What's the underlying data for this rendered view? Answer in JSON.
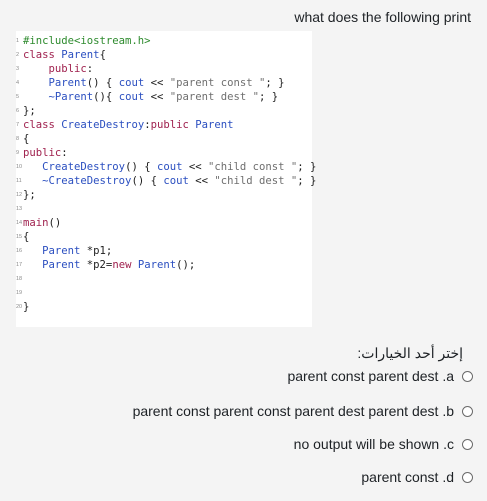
{
  "question": {
    "title": "what does the following print"
  },
  "code": {
    "lines": [
      {
        "n": "1",
        "parts": [
          {
            "t": "pre",
            "v": "#include<iostream.h>"
          }
        ]
      },
      {
        "n": "2",
        "parts": [
          {
            "t": "kw",
            "v": "class "
          },
          {
            "t": "type",
            "v": "Parent"
          },
          {
            "t": "plain",
            "v": "{"
          }
        ]
      },
      {
        "n": "3",
        "parts": [
          {
            "t": "plain",
            "v": "    "
          },
          {
            "t": "kw",
            "v": "public"
          },
          {
            "t": "plain",
            "v": ":"
          }
        ]
      },
      {
        "n": "4",
        "parts": [
          {
            "t": "plain",
            "v": "    "
          },
          {
            "t": "fn",
            "v": "Parent"
          },
          {
            "t": "plain",
            "v": "() { "
          },
          {
            "t": "fn",
            "v": "cout"
          },
          {
            "t": "plain",
            "v": " << "
          },
          {
            "t": "str",
            "v": "\"parent const \""
          },
          {
            "t": "plain",
            "v": "; }"
          }
        ]
      },
      {
        "n": "5",
        "parts": [
          {
            "t": "plain",
            "v": "    "
          },
          {
            "t": "fn",
            "v": "~Parent"
          },
          {
            "t": "plain",
            "v": "(){ "
          },
          {
            "t": "fn",
            "v": "cout"
          },
          {
            "t": "plain",
            "v": " << "
          },
          {
            "t": "str",
            "v": "\"parent dest \""
          },
          {
            "t": "plain",
            "v": "; }"
          }
        ]
      },
      {
        "n": "6",
        "parts": [
          {
            "t": "plain",
            "v": "};"
          }
        ]
      },
      {
        "n": "7",
        "parts": [
          {
            "t": "kw",
            "v": "class "
          },
          {
            "t": "type",
            "v": "CreateDestroy"
          },
          {
            "t": "plain",
            "v": ":"
          },
          {
            "t": "kw",
            "v": "public "
          },
          {
            "t": "type",
            "v": "Parent"
          }
        ]
      },
      {
        "n": "8",
        "parts": [
          {
            "t": "plain",
            "v": "{"
          }
        ]
      },
      {
        "n": "9",
        "parts": [
          {
            "t": "kw",
            "v": "public"
          },
          {
            "t": "plain",
            "v": ":"
          }
        ]
      },
      {
        "n": "10",
        "parts": [
          {
            "t": "plain",
            "v": "   "
          },
          {
            "t": "fn",
            "v": "CreateDestroy"
          },
          {
            "t": "plain",
            "v": "() { "
          },
          {
            "t": "fn",
            "v": "cout"
          },
          {
            "t": "plain",
            "v": " << "
          },
          {
            "t": "str",
            "v": "\"child const \""
          },
          {
            "t": "plain",
            "v": "; }"
          }
        ]
      },
      {
        "n": "11",
        "parts": [
          {
            "t": "plain",
            "v": "   "
          },
          {
            "t": "fn",
            "v": "~CreateDestroy"
          },
          {
            "t": "plain",
            "v": "() { "
          },
          {
            "t": "fn",
            "v": "cout"
          },
          {
            "t": "plain",
            "v": " << "
          },
          {
            "t": "str",
            "v": "\"child dest \""
          },
          {
            "t": "plain",
            "v": "; }"
          }
        ]
      },
      {
        "n": "12",
        "parts": [
          {
            "t": "plain",
            "v": "};"
          }
        ]
      },
      {
        "n": "13",
        "parts": []
      },
      {
        "n": "14",
        "parts": [
          {
            "t": "kw",
            "v": "main"
          },
          {
            "t": "plain",
            "v": "()"
          }
        ]
      },
      {
        "n": "15",
        "parts": [
          {
            "t": "plain",
            "v": "{"
          }
        ]
      },
      {
        "n": "16",
        "parts": [
          {
            "t": "plain",
            "v": "   "
          },
          {
            "t": "type",
            "v": "Parent"
          },
          {
            "t": "plain",
            "v": " *p1;"
          }
        ]
      },
      {
        "n": "17",
        "parts": [
          {
            "t": "plain",
            "v": "   "
          },
          {
            "t": "type",
            "v": "Parent"
          },
          {
            "t": "plain",
            "v": " *p2="
          },
          {
            "t": "kw",
            "v": "new "
          },
          {
            "t": "fn",
            "v": "Parent"
          },
          {
            "t": "plain",
            "v": "();"
          }
        ]
      },
      {
        "n": "18",
        "parts": []
      },
      {
        "n": "19",
        "parts": []
      },
      {
        "n": "20",
        "parts": [
          {
            "t": "plain",
            "v": "}"
          }
        ]
      }
    ]
  },
  "answers": {
    "prompt": "إختر أحد الخيارات:",
    "options": [
      {
        "label": "parent const parent dest .a"
      },
      {
        "label": "parent const parent const parent dest parent dest .b"
      },
      {
        "label": "no output will be shown .c"
      },
      {
        "label": "parent const .d"
      }
    ]
  },
  "colors": {
    "background": "#f4f4f4",
    "code_background": "#ffffff",
    "preprocessor": "#2e8b2e",
    "keyword": "#a0224f",
    "identifier": "#2b4fc0",
    "string": "#6f6f6f"
  }
}
